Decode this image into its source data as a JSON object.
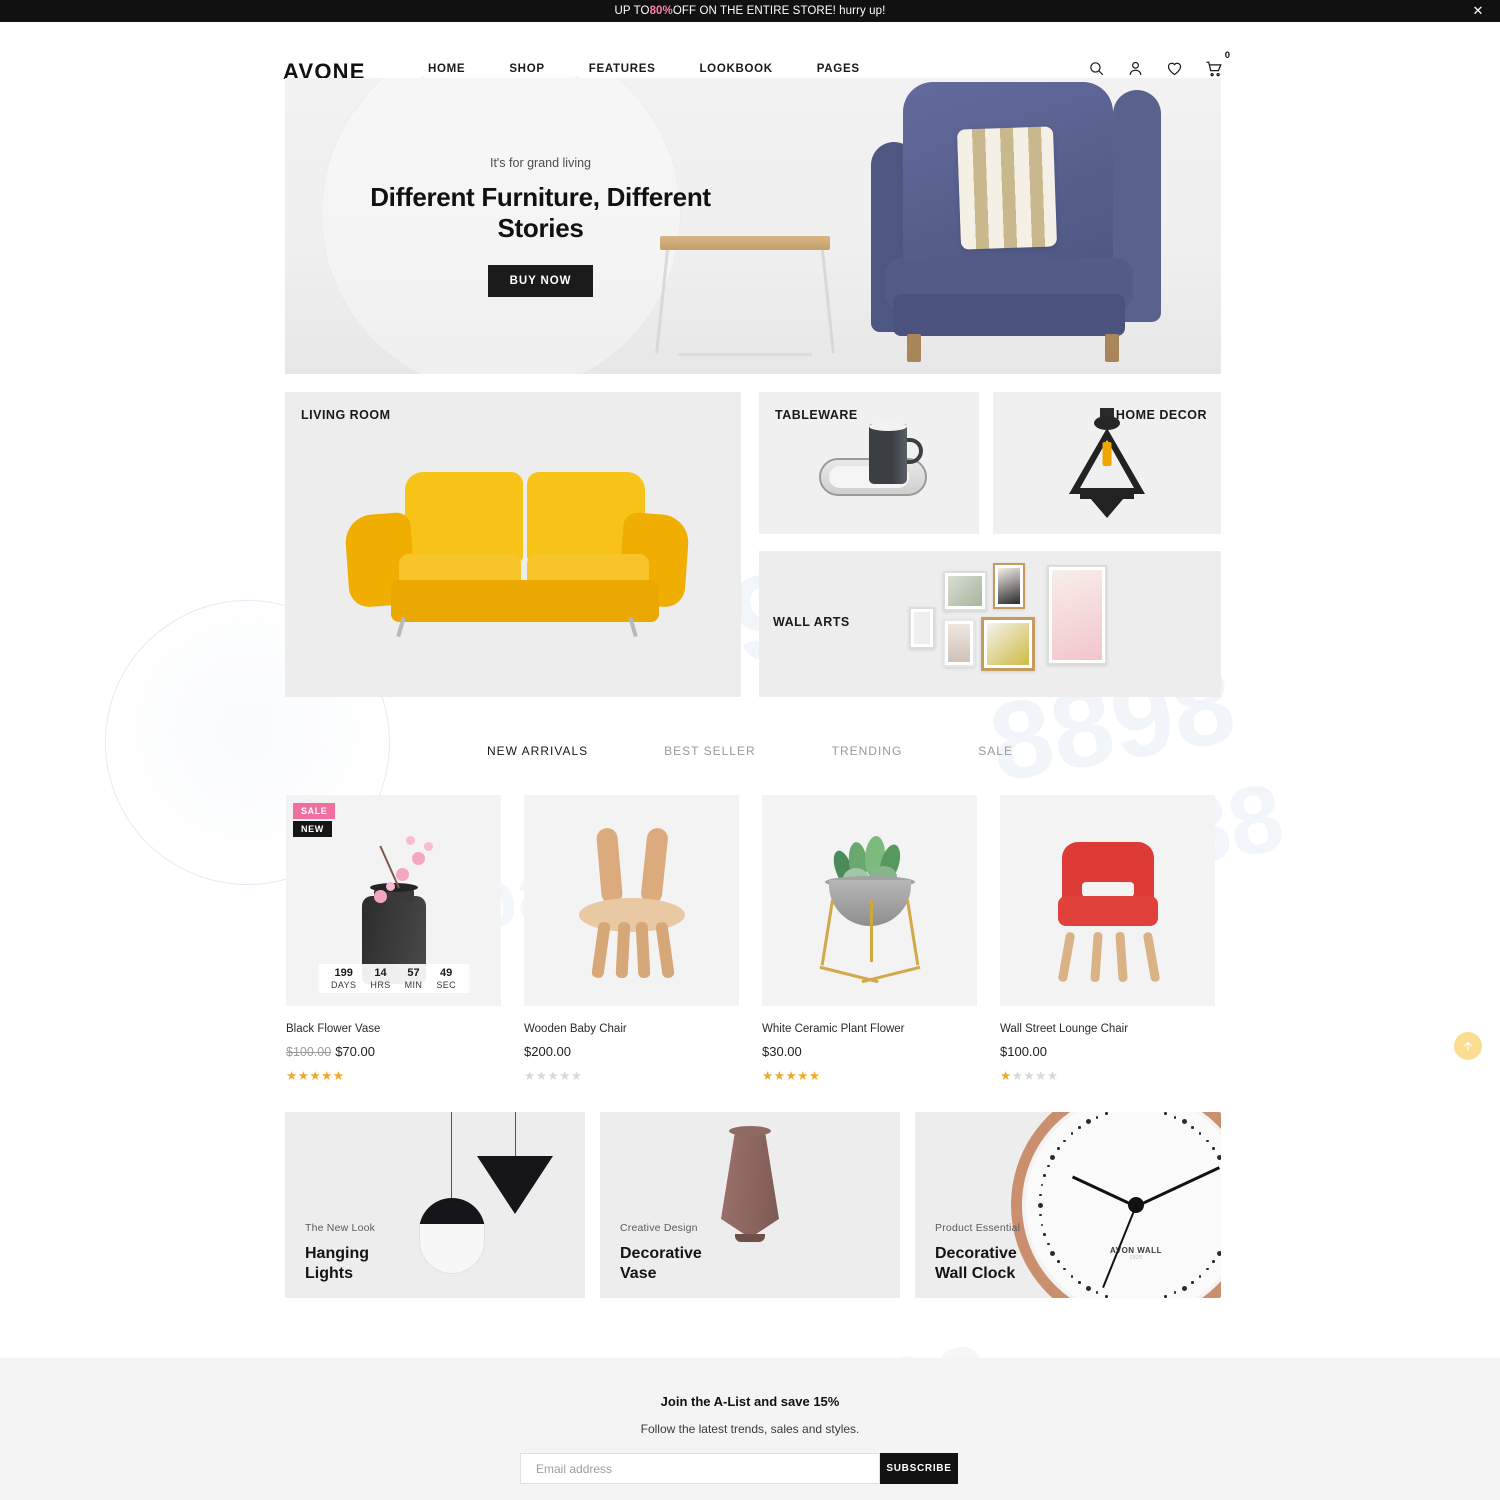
{
  "announcement": {
    "text_before": "UP TO ",
    "highlight": "80%",
    "text_after": " OFF ON THE ENTIRE STORE! hurry up!",
    "close_icon": "close-icon"
  },
  "header": {
    "logo": "AVONE",
    "nav": [
      {
        "label": "HOME"
      },
      {
        "label": "SHOP"
      },
      {
        "label": "FEATURES"
      },
      {
        "label": "LOOKBOOK"
      },
      {
        "label": "PAGES"
      }
    ],
    "icons": [
      {
        "name": "search-icon"
      },
      {
        "name": "account-icon"
      },
      {
        "name": "wishlist-heart-icon"
      },
      {
        "name": "cart-icon"
      }
    ],
    "cart_count": "0"
  },
  "hero": {
    "kicker": "It's for grand living",
    "title": "Different Furniture, Different Stories",
    "button": "BUY NOW"
  },
  "categories": [
    {
      "label": "LIVING ROOM"
    },
    {
      "label": "TABLEWARE"
    },
    {
      "label": "HOME DECOR"
    },
    {
      "label": "WALL ARTS"
    }
  ],
  "tabs": [
    {
      "label": "NEW ARRIVALS",
      "active": true
    },
    {
      "label": "BEST SELLER",
      "active": false
    },
    {
      "label": "TRENDING",
      "active": false
    },
    {
      "label": "SALE",
      "active": false
    }
  ],
  "products": [
    {
      "title": "Black Flower Vase",
      "old_price": "$100.00",
      "price": "$70.00",
      "rating": 5,
      "badges": [
        "SALE",
        "NEW"
      ],
      "countdown": {
        "days": "199",
        "days_label": "DAYS",
        "hrs": "14",
        "hrs_label": "HRS",
        "min": "57",
        "min_label": "MIN",
        "sec": "49",
        "sec_label": "SEC"
      }
    },
    {
      "title": "Wooden Baby Chair",
      "old_price": "",
      "price": "$200.00",
      "rating": 0
    },
    {
      "title": "White Ceramic Plant Flower",
      "old_price": "",
      "price": "$30.00",
      "rating": 5
    },
    {
      "title": "Wall Street Lounge Chair",
      "old_price": "",
      "price": "$100.00",
      "rating": 1
    }
  ],
  "promos": [
    {
      "kicker": "The New Look",
      "title": "Hanging\nLights"
    },
    {
      "kicker": "Creative Design",
      "title": "Decorative\nVase"
    },
    {
      "kicker": "Product Essential",
      "title": "Decorative\nWall Clock"
    }
  ],
  "clock_brand": {
    "name": "AVON WALL",
    "sub": "1925"
  },
  "newsletter": {
    "title": "Join the A-List and save 15%",
    "subtitle": "Follow the latest trends, sales and styles.",
    "placeholder": "Email address",
    "button": "SUBSCRIBE"
  },
  "scroll_top": {
    "icon": "arrow-up-icon"
  },
  "colors": {
    "accent_dark": "#111111",
    "sale_badge": "#f06fa0",
    "new_badge": "#161616",
    "star": "#f5a623",
    "scroll_top": "#fbd87e",
    "newsletter_bg": "#f4f4f4"
  }
}
